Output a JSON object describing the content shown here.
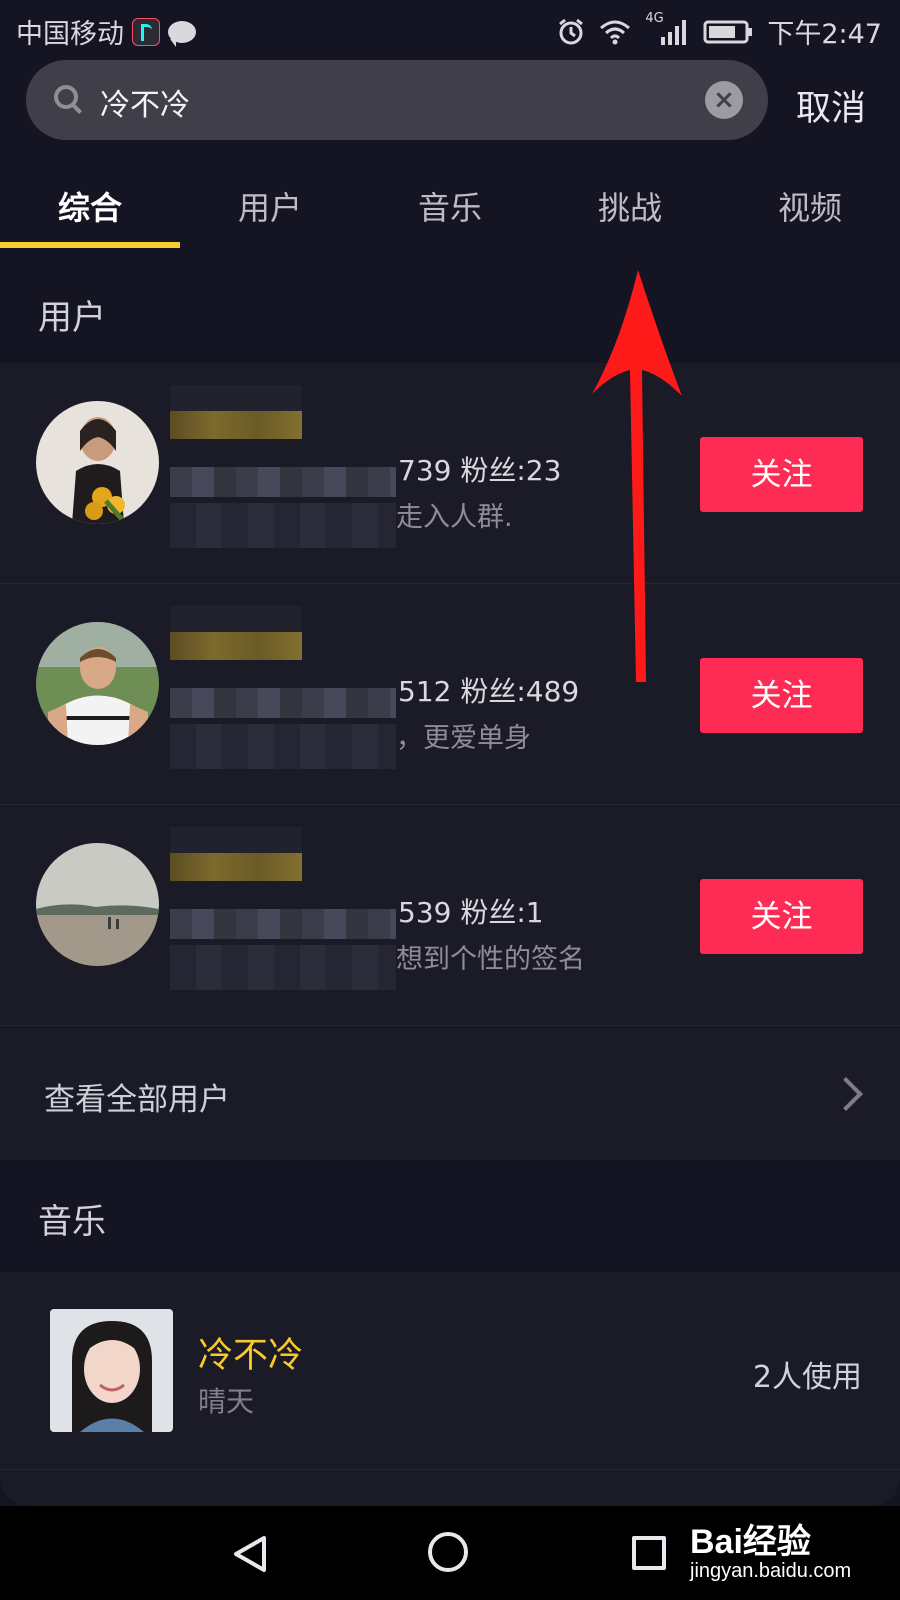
{
  "status_bar": {
    "carrier": "中国移动",
    "network": "4G",
    "time": "下午2:47",
    "icons": [
      "tiktok-app-icon",
      "chat-bubble-icon",
      "alarm-icon",
      "wifi-icon",
      "signal-icon",
      "battery-icon"
    ]
  },
  "search": {
    "query": "冷不冷",
    "cancel_label": "取消"
  },
  "tabs": [
    {
      "label": "综合",
      "active": true
    },
    {
      "label": "用户",
      "active": false
    },
    {
      "label": "音乐",
      "active": false
    },
    {
      "label": "挑战",
      "active": false
    },
    {
      "label": "视频",
      "active": false
    }
  ],
  "accent_colors": {
    "tab_indicator": "#facd2d",
    "follow_button": "#fe2c55",
    "music_title": "#f9c928",
    "annotation_arrow": "#ff1a1a"
  },
  "users_section": {
    "title": "用户",
    "users": [
      {
        "stats_visible": "739   粉丝:23",
        "bio_visible": "走入人群.",
        "follow_label": "关注"
      },
      {
        "stats_visible": "512   粉丝:489",
        "bio_visible": "，更爱单身",
        "follow_label": "关注"
      },
      {
        "stats_visible": "539   粉丝:1",
        "bio_visible": "想到个性的签名",
        "follow_label": "关注"
      }
    ],
    "see_all_label": "查看全部用户"
  },
  "music_section": {
    "title": "音乐",
    "items": [
      {
        "title": "冷不冷",
        "artist": "晴天",
        "usage": "2人使用"
      }
    ]
  },
  "watermark": {
    "brand": "Bai经验",
    "url": "jingyan.baidu.com"
  }
}
